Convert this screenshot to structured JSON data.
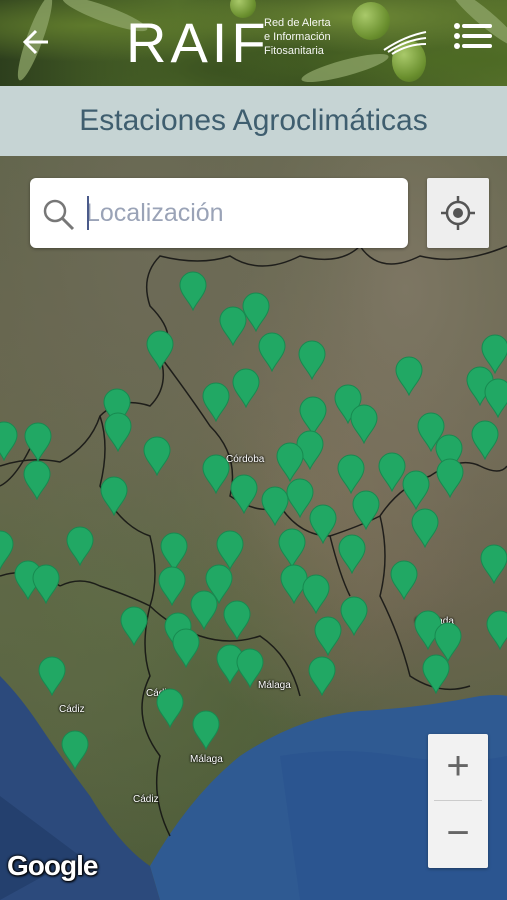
{
  "header": {
    "logo_text": "RAIF",
    "logo_subtitle_line1": "Red de Alerta",
    "logo_subtitle_line2": "e Información",
    "logo_subtitle_line3": "Fitosanitaria"
  },
  "title": "Estaciones Agroclimáticas",
  "search": {
    "placeholder": "Localización",
    "value": ""
  },
  "map": {
    "places": [
      "Córdoba",
      "Granada",
      "Cádiz",
      "Málaga",
      "Cádiz",
      "Cádiz",
      "Málaga"
    ],
    "attribution": "Google",
    "zoom_in": "+",
    "zoom_out": "−",
    "marker_color": "#21a864"
  },
  "icons": [
    "back-arrow-icon",
    "menu-icon",
    "search-icon",
    "locate-icon",
    "station-marker-icon"
  ]
}
